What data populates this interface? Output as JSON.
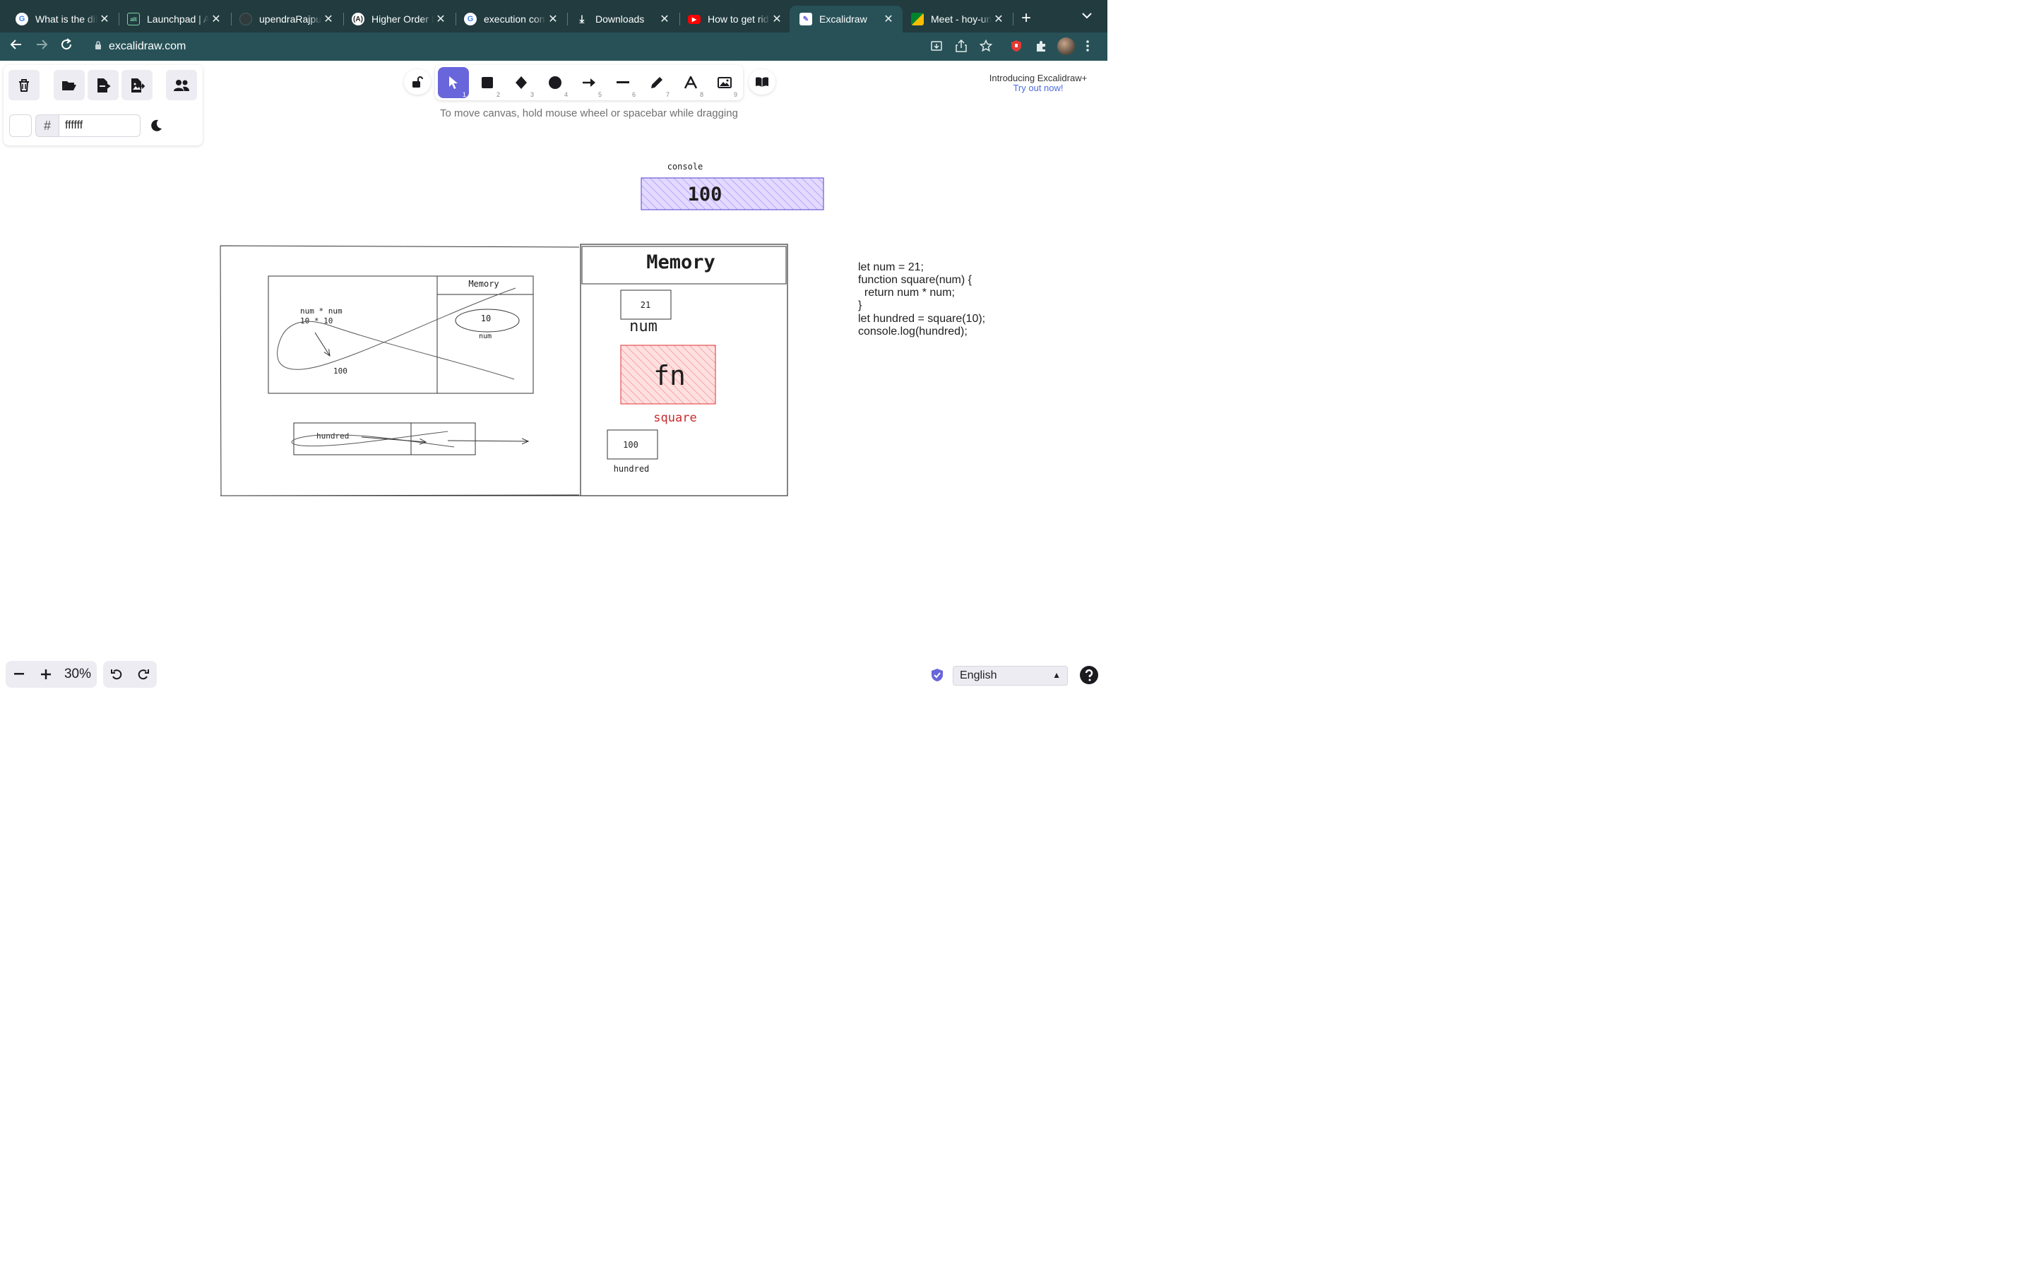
{
  "browser": {
    "tabs": [
      {
        "title": "What is the dif",
        "favicon": "G",
        "active": false
      },
      {
        "title": "Launchpad | A",
        "favicon": "alt",
        "active": false
      },
      {
        "title": "upendraRajput",
        "favicon": "github",
        "active": false
      },
      {
        "title": "Higher Order F",
        "favicon": "A",
        "active": false
      },
      {
        "title": "execution con",
        "favicon": "G",
        "active": false
      },
      {
        "title": "Downloads",
        "favicon": "download",
        "active": false
      },
      {
        "title": "How to get rid",
        "favicon": "youtube",
        "active": false
      },
      {
        "title": "Excalidraw",
        "favicon": "excalidraw",
        "active": true
      },
      {
        "title": "Meet - hoy-un",
        "favicon": "meet",
        "active": false
      }
    ],
    "new_tab": "+",
    "url": "excalidraw.com",
    "colors": {
      "tabstrip": "#213b3f",
      "toolbar": "#275157"
    }
  },
  "excalidraw": {
    "color_hash": "#",
    "color_value": "ffffff",
    "hint": "To move canvas, hold mouse wheel or spacebar while dragging",
    "promo_title": "Introducing Excalidraw+",
    "promo_link": "Try out now!",
    "tools": [
      {
        "icon": "pointer-icon",
        "key": "1",
        "selected": true
      },
      {
        "icon": "rectangle-icon",
        "key": "2",
        "selected": false
      },
      {
        "icon": "diamond-icon",
        "key": "3",
        "selected": false
      },
      {
        "icon": "ellipse-icon",
        "key": "4",
        "selected": false
      },
      {
        "icon": "arrow-icon",
        "key": "5",
        "selected": false
      },
      {
        "icon": "line-icon",
        "key": "6",
        "selected": false
      },
      {
        "icon": "pencil-icon",
        "key": "7",
        "selected": false
      },
      {
        "icon": "text-icon",
        "key": "8",
        "selected": false
      },
      {
        "icon": "image-icon",
        "key": "9",
        "selected": false
      }
    ],
    "accent": "#6965db",
    "zoom": "30%",
    "language": "English"
  },
  "drawing": {
    "console_label": "console",
    "console_value": "100",
    "memory_title": "Memory",
    "num_value": "21",
    "num_label": "num",
    "fn_text": "fn",
    "square_label": "square",
    "hundred_value": "100",
    "hundred_label": "hundred",
    "inner_memory_title": "Memory",
    "inner_num_value": "10",
    "inner_num_label": "num",
    "code_line1": "num * num",
    "code_line2": "10 * 10",
    "result": "100",
    "inner_hundred": "hundred",
    "code": [
      "let num = 21;",
      "function square(num) {",
      "  return num * num;",
      "}",
      "let hundred = square(10);",
      "console.log(hundred);"
    ],
    "colors": {
      "console_fill": "#d0bfff",
      "console_stroke": "#6c5bd4",
      "fn_fill": "#ffc9c9",
      "fn_stroke": "#e03131",
      "square_text": "#c92a2a"
    }
  }
}
